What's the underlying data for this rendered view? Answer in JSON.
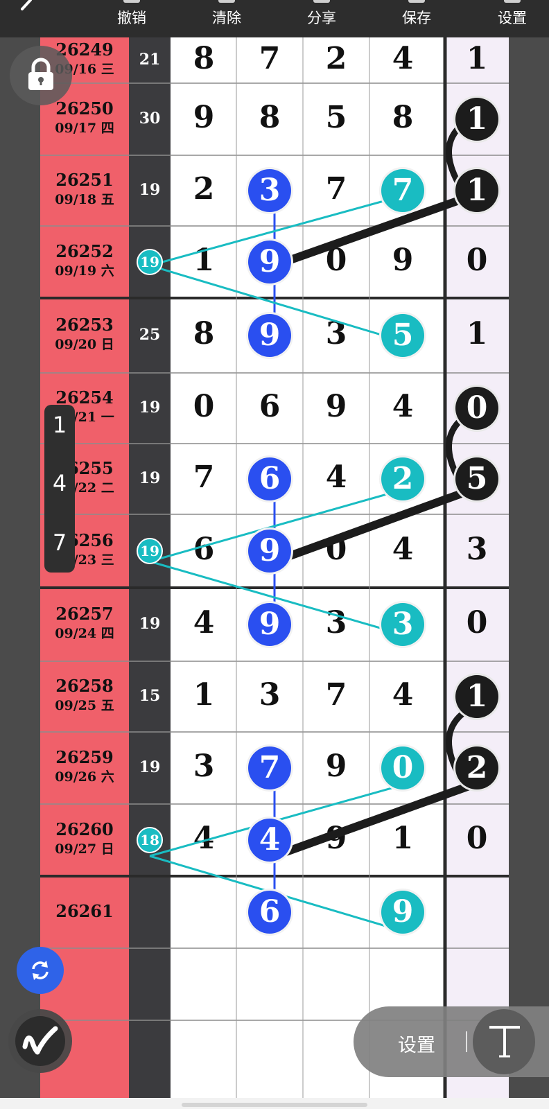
{
  "toolbar": {
    "back_icon": "chevron-left-icon",
    "items": [
      {
        "label": "撤销"
      },
      {
        "label": "清除"
      },
      {
        "label": "分享"
      },
      {
        "label": "保存"
      },
      {
        "label": "设置"
      }
    ]
  },
  "rows": [
    {
      "issue": "26249",
      "date": "09/16 三",
      "sum": "21",
      "digits": [
        "8",
        "7",
        "2",
        "4"
      ],
      "tail": "1"
    },
    {
      "issue": "26250",
      "date": "09/17 四",
      "sum": "30",
      "digits": [
        "9",
        "8",
        "5",
        "8"
      ],
      "tail": "1"
    },
    {
      "issue": "26251",
      "date": "09/18 五",
      "sum": "19",
      "digits": [
        "2",
        "3",
        "7",
        "7"
      ],
      "tail": "1"
    },
    {
      "issue": "26252",
      "date": "09/19 六",
      "sum": "19",
      "digits": [
        "1",
        "9",
        "0",
        "9"
      ],
      "tail": "0"
    },
    {
      "issue": "26253",
      "date": "09/20 日",
      "sum": "25",
      "digits": [
        "8",
        "9",
        "3",
        "5"
      ],
      "tail": "1"
    },
    {
      "issue": "26254",
      "date": "09/21 一",
      "sum": "19",
      "digits": [
        "0",
        "6",
        "9",
        "4"
      ],
      "tail": "0"
    },
    {
      "issue": "26255",
      "date": "09/22 二",
      "sum": "19",
      "digits": [
        "7",
        "6",
        "4",
        "2"
      ],
      "tail": "5"
    },
    {
      "issue": "26256",
      "date": "09/23 三",
      "sum": "19",
      "digits": [
        "6",
        "9",
        "0",
        "4"
      ],
      "tail": "3"
    },
    {
      "issue": "26257",
      "date": "09/24 四",
      "sum": "19",
      "digits": [
        "4",
        "9",
        "3",
        "3"
      ],
      "tail": "0"
    },
    {
      "issue": "26258",
      "date": "09/25 五",
      "sum": "15",
      "digits": [
        "1",
        "3",
        "7",
        "4"
      ],
      "tail": "1"
    },
    {
      "issue": "26259",
      "date": "09/26 六",
      "sum": "19",
      "digits": [
        "3",
        "7",
        "9",
        "0"
      ],
      "tail": "2"
    },
    {
      "issue": "26260",
      "date": "09/27 日",
      "sum": "18",
      "digits": [
        "4",
        "4",
        "9",
        "1"
      ],
      "tail": "0"
    },
    {
      "issue": "26261",
      "date": "",
      "sum": "",
      "digits": [
        "",
        "6",
        "",
        "9"
      ],
      "tail": ""
    }
  ],
  "side_popup": {
    "options": [
      "1",
      "4",
      "7"
    ]
  },
  "settings_pill": {
    "label": "设置",
    "text_tool_icon": "text-tool-icon"
  },
  "icons": {
    "lock": "lock-icon",
    "refresh": "refresh-icon",
    "pen": "pen-icon"
  },
  "colors": {
    "issue_column": "#f0606a",
    "blue_ball": "#2a4ff0",
    "cyan_ball": "#19bcc2",
    "black_ball": "#1c1c1c",
    "tail_column": "#f4eef8"
  }
}
